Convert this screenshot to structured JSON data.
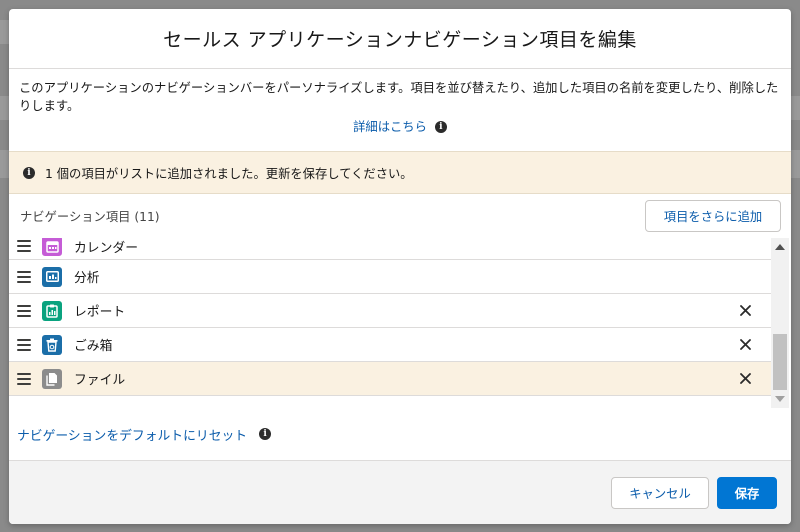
{
  "modal": {
    "title": "セールス アプリケーションナビゲーション項目を編集",
    "intro": "このアプリケーションのナビゲーションバーをパーソナライズします。項目を並び替えたり、追加した項目の名前を変更したり、削除したりします。",
    "learn_more": "詳細はこちら",
    "notice": "1 個の項目がリストに追加されました。更新を保存してください。",
    "nav_count": "ナビゲーション項目 (11)",
    "add_button": "項目をさらに追加",
    "reset_link": "ナビゲーションをデフォルトにリセット",
    "cancel_button": "キャンセル",
    "save_button": "保存"
  },
  "items": [
    {
      "label": "カレンダー",
      "icon": "calendar-icon",
      "color": "#c55cd6",
      "removable": false
    },
    {
      "label": "分析",
      "icon": "analytics-icon",
      "color": "#1b6ea8",
      "removable": false
    },
    {
      "label": "レポート",
      "icon": "report-icon",
      "color": "#0aa37f",
      "removable": true
    },
    {
      "label": "ごみ箱",
      "icon": "trash-icon",
      "color": "#1b6ea8",
      "removable": true
    },
    {
      "label": "ファイル",
      "icon": "file-icon",
      "color": "#8c8c8c",
      "removable": true
    }
  ],
  "colors": {
    "brand": "#0176d3",
    "link": "#0b5cab",
    "notice_bg": "#faf1e1"
  }
}
